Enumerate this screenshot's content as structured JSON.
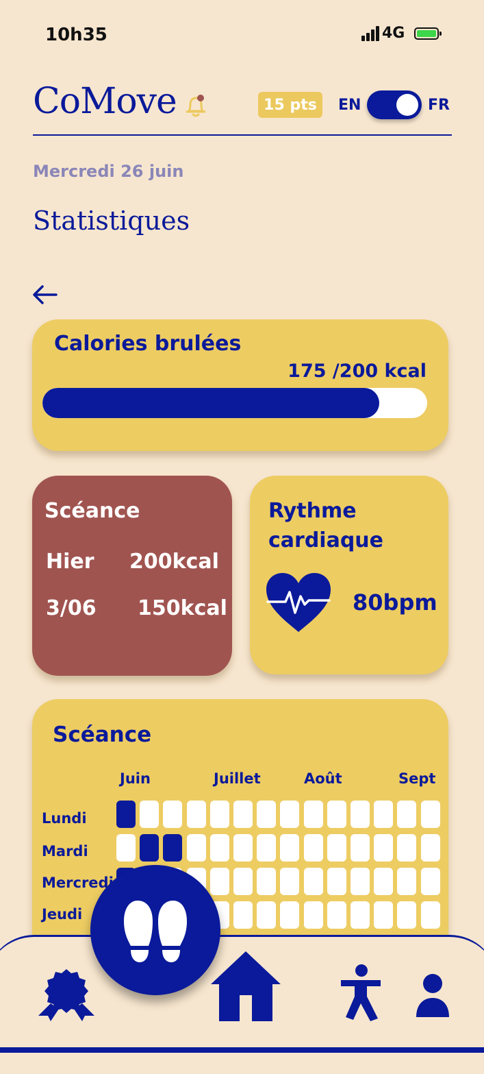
{
  "status_bar": {
    "time": "10h35",
    "network": "4G"
  },
  "header": {
    "logo": "CoMove",
    "points": "15 pts",
    "lang_left": "EN",
    "lang_right": "FR",
    "toggle_on": true
  },
  "date": "Mercredi 26 juin",
  "page_title": "Statistiques",
  "calories": {
    "title": "Calories brulées",
    "value_label": "175 /200 kcal",
    "current": 175,
    "goal": 200
  },
  "sessions": {
    "title": "Scéance",
    "rows": [
      {
        "label": "Hier",
        "value": "200kcal"
      },
      {
        "label": "3/06",
        "value": "150kcal"
      }
    ]
  },
  "heart_rate": {
    "title": "Rythme cardiaque",
    "value": "80bpm"
  },
  "calendar": {
    "title": "Scéance",
    "months": [
      "Juin",
      "Juillet",
      "Août",
      "Sept"
    ],
    "days": [
      "Lundi",
      "Mardi",
      "Mercredi",
      "Jeudi"
    ],
    "columns": 14,
    "active": {
      "Lundi": [
        0
      ],
      "Mardi": [
        1,
        2
      ],
      "Mercredi": [
        0
      ],
      "Jeudi": []
    }
  },
  "colors": {
    "primary": "#0a1a9a",
    "background": "#f7e6cf",
    "yellow": "#edcc62",
    "session": "#a05450"
  },
  "nav": {
    "icons": [
      "badge-icon",
      "footsteps-icon",
      "home-icon",
      "exercise-icon",
      "profile-icon"
    ]
  }
}
